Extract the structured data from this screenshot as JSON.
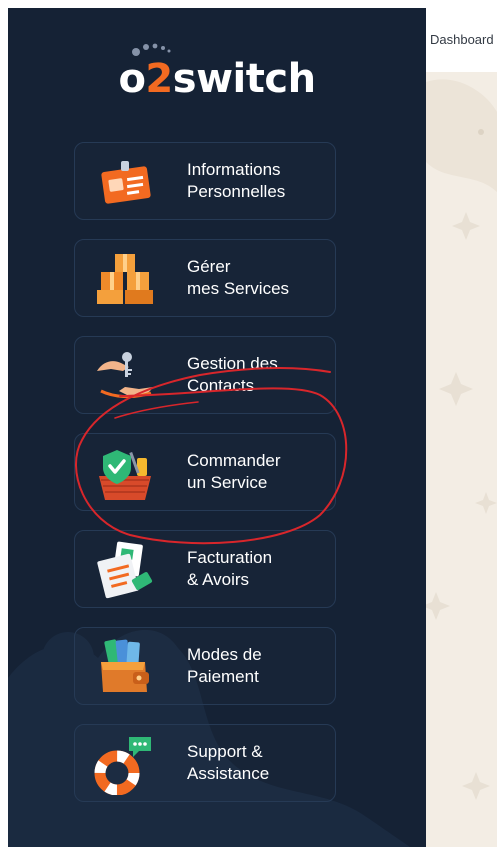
{
  "brand": {
    "logo_prefix": "o",
    "logo_digit": "2",
    "logo_suffix": "switch",
    "accent_color": "#f26a21",
    "sidebar_color": "#152235"
  },
  "sidebar": {
    "items": [
      {
        "label": "Informations\nPersonnelles",
        "icon": "id-card-icon"
      },
      {
        "label": "Gérer\nmes Services",
        "icon": "boxes-icon"
      },
      {
        "label": "Gestion des\nContacts",
        "icon": "handshake-icon"
      },
      {
        "label": "Commander\nun Service",
        "icon": "shopping-basket-icon"
      },
      {
        "label": "Facturation\n& Avoirs",
        "icon": "invoice-icon"
      },
      {
        "label": "Modes de\nPaiement",
        "icon": "wallet-icon"
      },
      {
        "label": "Support &\nAssistance",
        "icon": "lifebuoy-icon"
      }
    ]
  },
  "main": {
    "breadcrumb": "Dashboard"
  },
  "annotation": {
    "color": "#d8262b",
    "shape": "hand-drawn circle around Commander un Service"
  }
}
